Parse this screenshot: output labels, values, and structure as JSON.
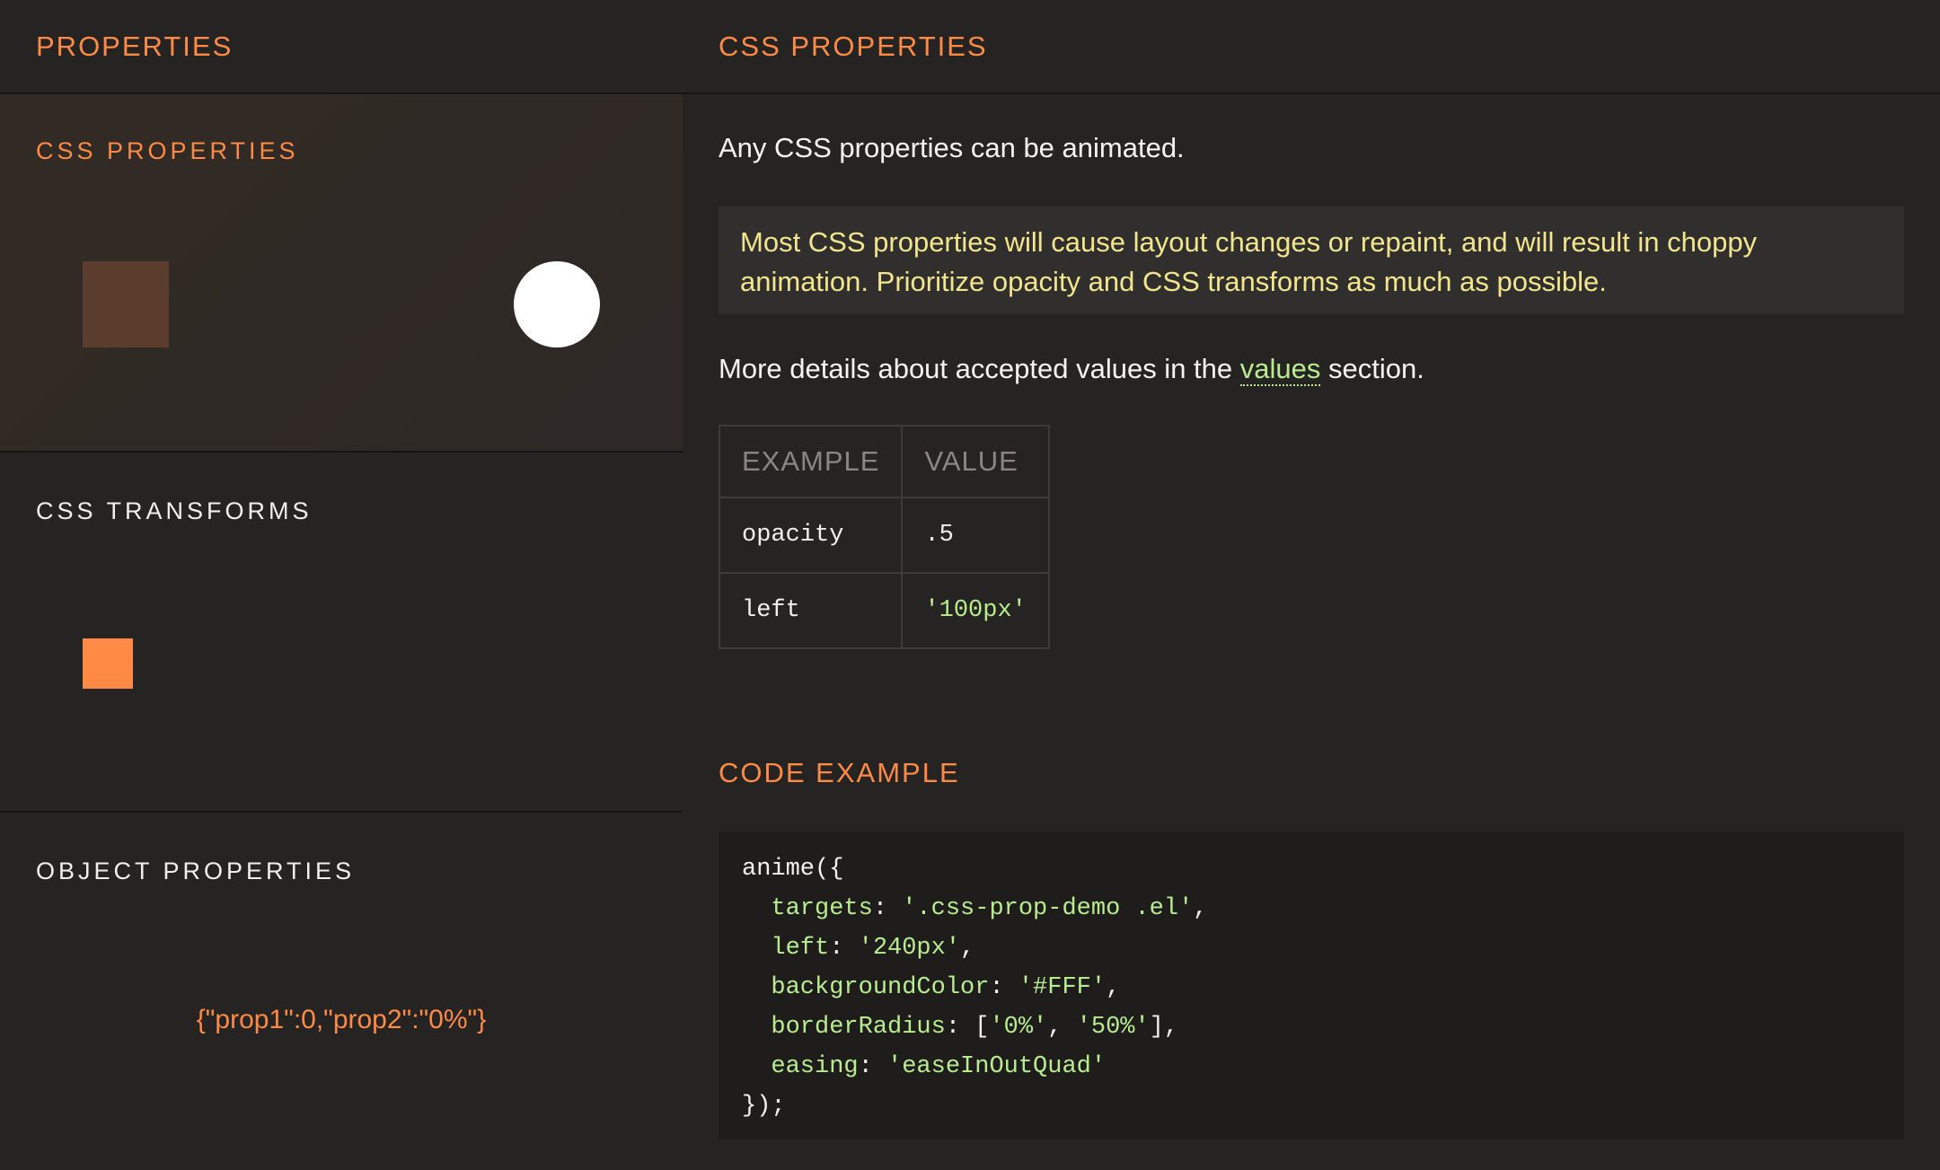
{
  "left_header": {
    "title": "PROPERTIES"
  },
  "right_header": {
    "title": "CSS PROPERTIES"
  },
  "demos": {
    "css_properties": {
      "title": "CSS PROPERTIES"
    },
    "css_transforms": {
      "title": "CSS TRANSFORMS"
    },
    "object_properties": {
      "title": "OBJECT PROPERTIES",
      "readout": "{\"prop1\":0,\"prop2\":\"0%\"}"
    }
  },
  "content": {
    "intro": "Any CSS properties can be animated.",
    "callout": "Most CSS properties will cause layout changes or repaint, and will result in choppy animation. Prioritize opacity and CSS transforms as much as possible.",
    "more_before": "More details about accepted values in the ",
    "more_link": "values",
    "more_after": " section.",
    "table": {
      "headers": [
        "EXAMPLE",
        "VALUE"
      ],
      "rows": [
        {
          "example": "opacity",
          "value": ".5"
        },
        {
          "example": "left",
          "value": "'100px'"
        }
      ]
    },
    "code_title": "CODE EXAMPLE",
    "code": {
      "l1": "anime({",
      "targets_key": "targets",
      "targets_val": "'.css-prop-demo .el'",
      "left_key": "left",
      "left_val": "'240px'",
      "bg_key": "backgroundColor",
      "bg_val": "'#FFF'",
      "br_key": "borderRadius",
      "br_v1": "'0%'",
      "br_v2": "'50%'",
      "easing_key": "easing",
      "easing_val": "'easeInOutQuad'",
      "close": "});"
    }
  },
  "colors": {
    "accent": "#ff8a45",
    "string": "#b9ec8e",
    "callout_text": "#f2e58e",
    "background": "#252423"
  }
}
